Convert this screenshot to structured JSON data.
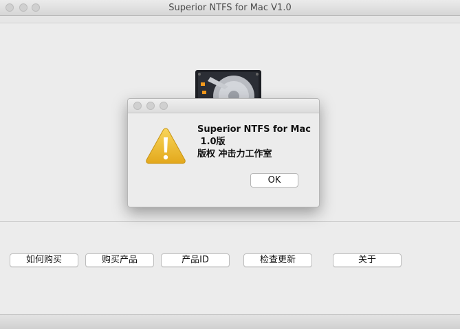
{
  "window": {
    "title": "Superior NTFS for Mac V1.0"
  },
  "buttons": {
    "how_to_buy": "如何购买",
    "buy_product": "购买产品",
    "product_id": "产品ID",
    "check_update": "检查更新",
    "about": "关于"
  },
  "dialog": {
    "title_line1": "Superior NTFS for Mac",
    "title_line2": " 1.0版",
    "body": "版权 冲击力工作室",
    "ok_label": "OK"
  },
  "icons": {
    "dialog_icon": "warning-icon",
    "background_image": "hard-disk-icon"
  },
  "colors": {
    "window_bg": "#ececec",
    "warning_yellow": "#f2c12e"
  }
}
